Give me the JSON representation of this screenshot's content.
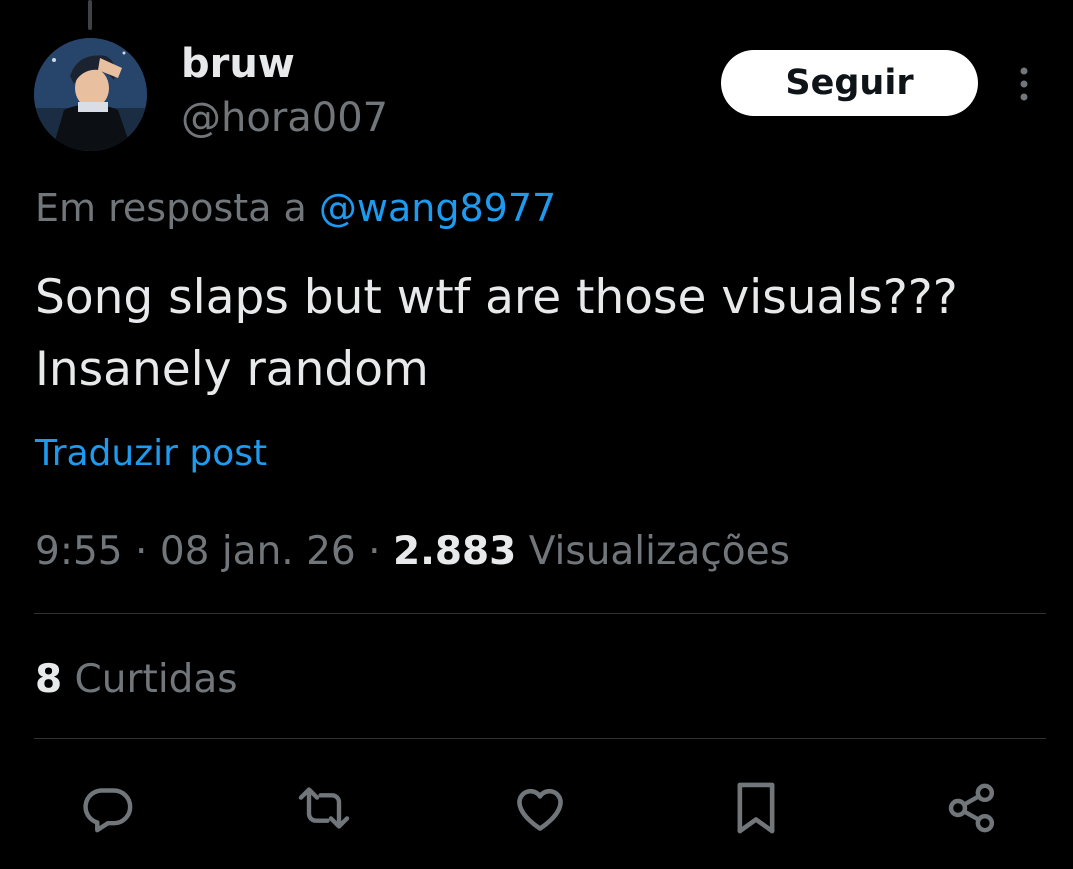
{
  "author": {
    "display_name": "bruw",
    "handle": "@hora007"
  },
  "follow_button": {
    "label": "Seguir"
  },
  "reply": {
    "prefix": "Em resposta a",
    "mention": "@wang8977"
  },
  "post": {
    "lines": [
      "Song slaps but wtf are those visuals???",
      "Insanely random"
    ],
    "translate_label": "Traduzir post"
  },
  "meta": {
    "time": "9:55",
    "date": "08 jan. 26",
    "separator": "·",
    "views_count": "2.883",
    "views_label": "Visualizações"
  },
  "likes": {
    "count": "8",
    "label": "Curtidas"
  },
  "actions": [
    {
      "icon": "reply-icon"
    },
    {
      "icon": "repost-icon"
    },
    {
      "icon": "like-heart-icon"
    },
    {
      "icon": "bookmark-icon"
    },
    {
      "icon": "share-icon"
    }
  ],
  "colors": {
    "background": "#000000",
    "text_primary": "#e7e9ea",
    "text_secondary": "#71767b",
    "link": "#1d9bf0",
    "divider": "#2f3336",
    "follow_bg": "#ffffff",
    "follow_text": "#0f1419"
  }
}
